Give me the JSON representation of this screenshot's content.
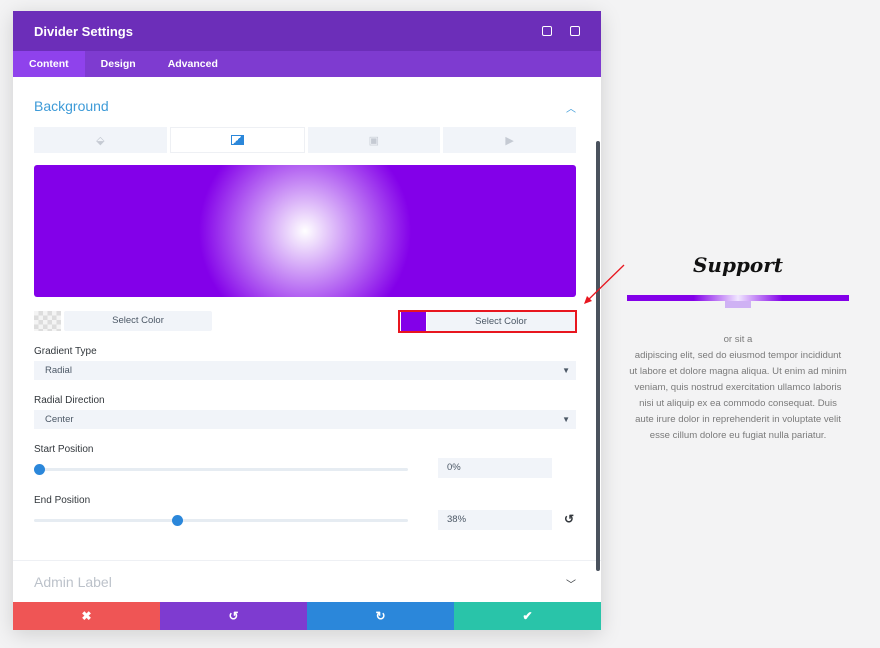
{
  "modal": {
    "title": "Divider Settings",
    "tabs": [
      {
        "label": "Content",
        "active": true
      },
      {
        "label": "Design"
      },
      {
        "label": "Advanced"
      }
    ],
    "background": {
      "title": "Background",
      "bg_tabs": [
        "paint-bucket-icon",
        "gradient-icon",
        "image-icon",
        "video-icon"
      ],
      "active_tab": "gradient",
      "gradient_colors": [
        "#ffffff",
        "#8300e9"
      ],
      "color1_label": "Select Color",
      "color2_label": "Select Color",
      "gradient_type_label": "Gradient Type",
      "gradient_type": "Radial",
      "radial_direction_label": "Radial Direction",
      "radial_direction": "Center",
      "start_label": "Start Position",
      "start_value": "0%",
      "end_label": "End Position",
      "end_value": "38%"
    },
    "admin_label": "Admin Label",
    "footer": [
      "close-icon",
      "undo-icon",
      "redo-icon",
      "check-icon"
    ]
  },
  "preview": {
    "title": "Support",
    "text_lines": [
      "or sit a",
      "adipiscing elit, sed do eiusmod tempor incididunt",
      "ut labore et dolore magna aliqua. Ut enim ad minim",
      "veniam, quis nostrud exercitation ullamco laboris",
      "nisi ut aliquip ex ea commodo consequat. Duis",
      "aute irure dolor in reprehenderit in voluptate velit",
      "esse cillum dolore eu fugiat nulla pariatur."
    ]
  },
  "colors": {
    "header": "#6c2eb9",
    "accent": "#8300e9",
    "highlight": "#e8161f"
  }
}
